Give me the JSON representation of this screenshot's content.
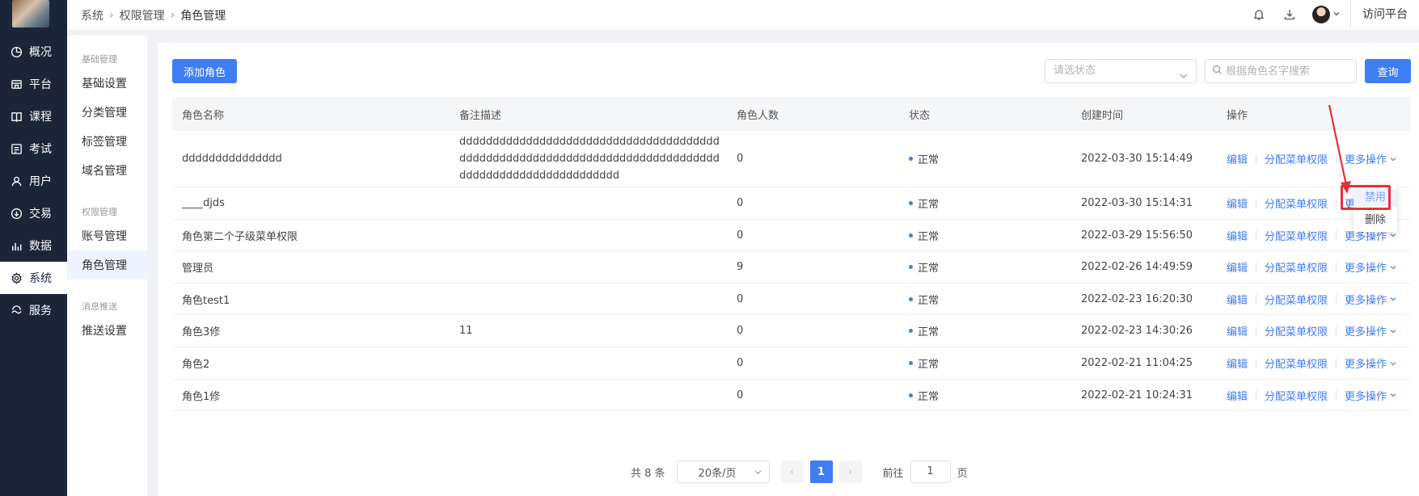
{
  "nav": {
    "items": [
      {
        "label": "概况",
        "icon": "pie-chart-icon"
      },
      {
        "label": "平台",
        "icon": "platform-icon"
      },
      {
        "label": "课程",
        "icon": "book-icon"
      },
      {
        "label": "考试",
        "icon": "exam-icon"
      },
      {
        "label": "用户",
        "icon": "user-icon"
      },
      {
        "label": "交易",
        "icon": "trade-icon"
      },
      {
        "label": "数据",
        "icon": "bar-chart-icon"
      },
      {
        "label": "系统",
        "icon": "gear-icon"
      },
      {
        "label": "服务",
        "icon": "service-icon"
      }
    ]
  },
  "subnav": {
    "groups": [
      {
        "title": "基础管理",
        "items": [
          "基础设置",
          "分类管理",
          "标签管理",
          "域名管理"
        ]
      },
      {
        "title": "权限管理",
        "items": [
          "账号管理",
          "角色管理"
        ]
      },
      {
        "title": "消息推送",
        "items": [
          "推送设置"
        ]
      }
    ]
  },
  "breadcrumb": {
    "items": [
      "系统",
      "权限管理",
      "角色管理"
    ]
  },
  "topbar": {
    "visit_label": "访问平台"
  },
  "toolbar": {
    "add_label": "添加角色",
    "status_placeholder": "请选状态",
    "search_placeholder": "根据角色名字搜索",
    "query_label": "查询"
  },
  "table": {
    "headers": [
      "角色名称",
      "备注描述",
      "角色人数",
      "状态",
      "创建时间",
      "操作"
    ],
    "rows": [
      {
        "name": "ddddddddddddddd",
        "desc": "dddddddddddddddddddddddddddddddddddddddddddddddddddddddddddddddddddddddddddddddddddddddddddddddddddddd",
        "count": "0",
        "status": "正常",
        "time": "2022-03-30 15:14:49"
      },
      {
        "name": "____djds",
        "desc": "",
        "count": "0",
        "status": "正常",
        "time": "2022-03-30 15:14:31"
      },
      {
        "name": "角色第二个子级菜单权限",
        "desc": "",
        "count": "0",
        "status": "正常",
        "time": "2022-03-29 15:56:50"
      },
      {
        "name": "管理员",
        "desc": "",
        "count": "9",
        "status": "正常",
        "time": "2022-02-26 14:49:59"
      },
      {
        "name": "角色test1",
        "desc": "",
        "count": "0",
        "status": "正常",
        "time": "2022-02-23 16:20:30"
      },
      {
        "name": "角色3修",
        "desc": "11",
        "count": "0",
        "status": "正常",
        "time": "2022-02-23 14:30:26"
      },
      {
        "name": "角色2",
        "desc": "",
        "count": "0",
        "status": "正常",
        "time": "2022-02-21 11:04:25"
      },
      {
        "name": "角色1修",
        "desc": "",
        "count": "0",
        "status": "正常",
        "time": "2022-02-21 10:24:31"
      }
    ],
    "ops": {
      "edit": "编辑",
      "assign": "分配菜单权限",
      "more": "更多操作"
    }
  },
  "dropdown": {
    "disable": "禁用",
    "delete": "删除"
  },
  "pagination": {
    "total": "共 8 条",
    "page_size": "20条/页",
    "current": "1",
    "goto_prefix": "前往",
    "goto_value": "1",
    "goto_suffix": "页"
  },
  "colors": {
    "primary": "#3f7df2",
    "nav_bg": "#1c2538",
    "highlight": "#e8303a"
  }
}
